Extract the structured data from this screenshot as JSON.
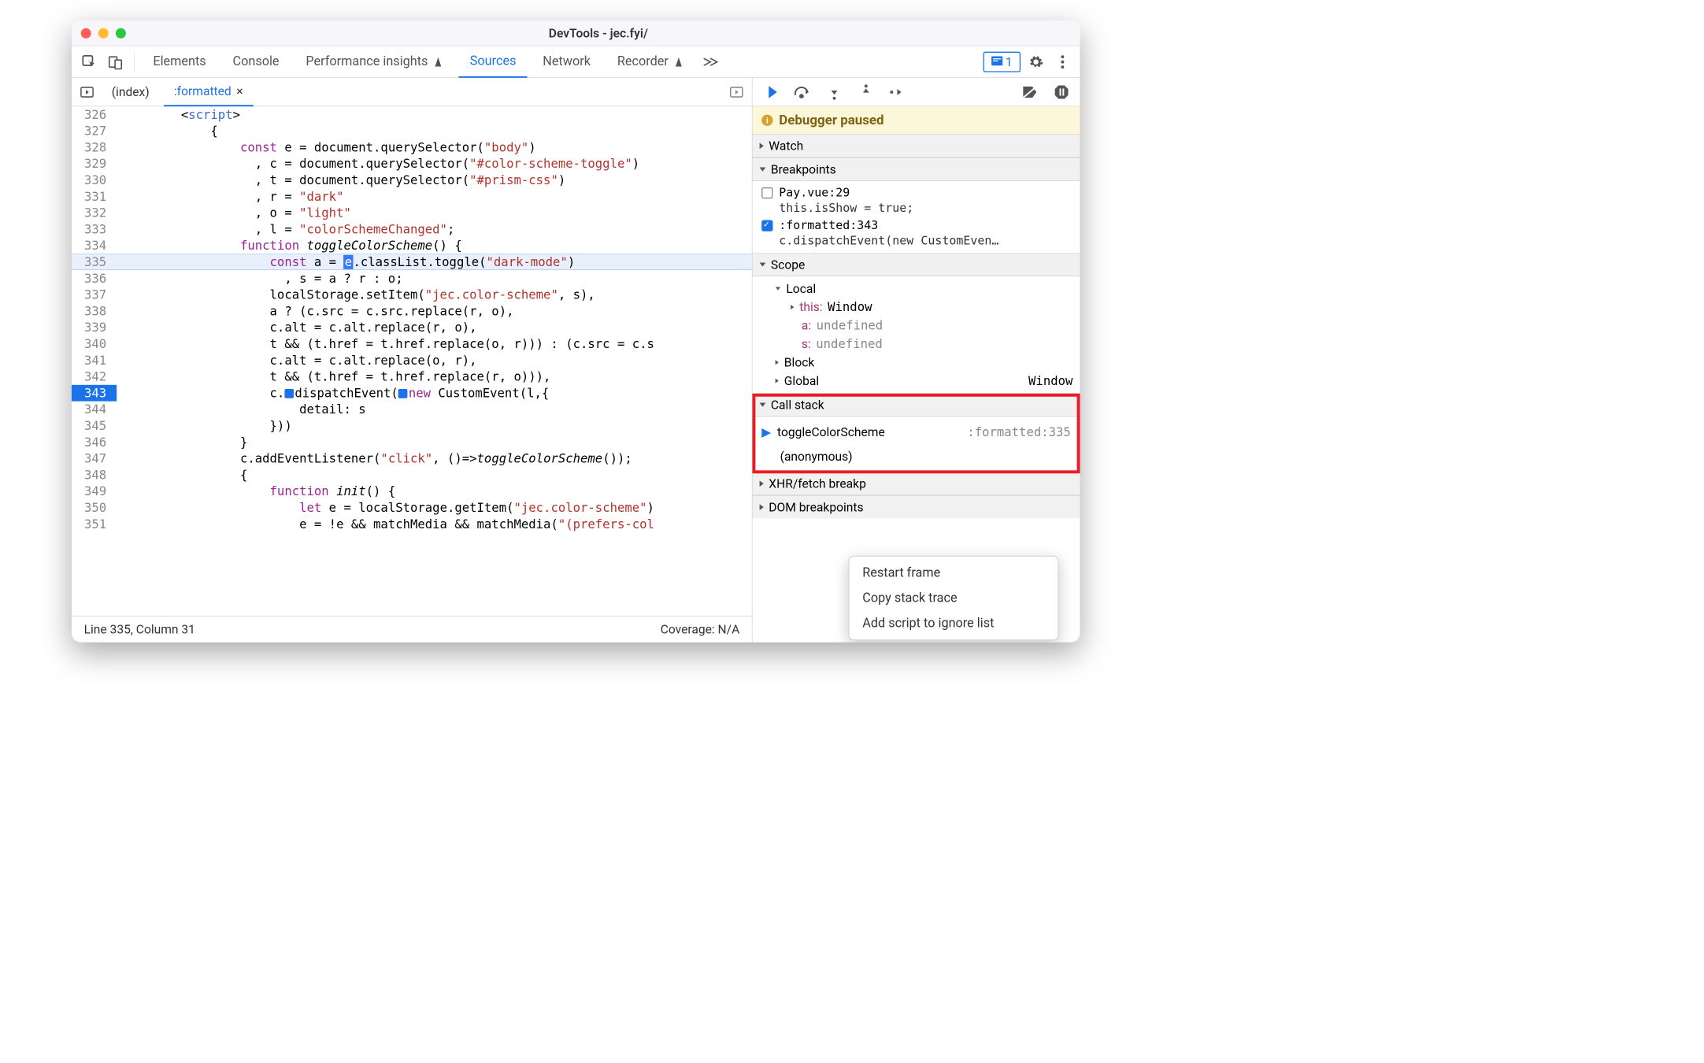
{
  "window": {
    "title": "DevTools - jec.fyi/"
  },
  "tabs": {
    "elements": "Elements",
    "console": "Console",
    "perf": "Performance insights",
    "sources": "Sources",
    "network": "Network",
    "recorder": "Recorder",
    "issues_count": "1"
  },
  "filetabs": {
    "index": "(index)",
    "formatted": ":formatted"
  },
  "lines": {
    "326": "        <script>",
    "327": "            {",
    "328": "                const e = document.querySelector(\"body\")",
    "329": "                  , c = document.querySelector(\"#color-scheme-toggle\")",
    "330": "                  , t = document.querySelector(\"#prism-css\")",
    "331": "                  , r = \"dark\"",
    "332": "                  , o = \"light\"",
    "333": "                  , l = \"colorSchemeChanged\";",
    "334": "                function toggleColorScheme() {",
    "335": "                    const a = e.classList.toggle(\"dark-mode\")",
    "336": "                      , s = a ? r : o;",
    "337": "                    localStorage.setItem(\"jec.color-scheme\", s),",
    "338": "                    a ? (c.src = c.src.replace(r, o),",
    "339": "                    c.alt = c.alt.replace(r, o),",
    "340": "                    t && (t.href = t.href.replace(o, r))) : (c.src = c.s",
    "341": "                    c.alt = c.alt.replace(o, r),",
    "342": "                    t && (t.href = t.href.replace(r, o))),",
    "343": "                    c.dispatchEvent(new CustomEvent(l,{",
    "344": "                        detail: s",
    "345": "                    }))",
    "346": "                }",
    "347": "                c.addEventListener(\"click\", ()=>toggleColorScheme());",
    "348": "                {",
    "349": "                    function init() {",
    "350": "                        let e = localStorage.getItem(\"jec.color-scheme\")",
    "351": "                        e = !e && matchMedia && matchMedia(\"(prefers-col"
  },
  "status": {
    "pos": "Line 335, Column 31",
    "coverage": "Coverage: N/A"
  },
  "debugger": {
    "banner": "Debugger paused",
    "watch": "Watch",
    "breakpoints": {
      "title": "Breakpoints",
      "items": [
        {
          "file": "Pay.vue:29",
          "code": "this.isShow = true;",
          "checked": false
        },
        {
          "file": ":formatted:343",
          "code": "c.dispatchEvent(new CustomEven…",
          "checked": true
        }
      ]
    },
    "scope": {
      "title": "Scope",
      "local": "Local",
      "this": "this:",
      "this_val": "Window",
      "a": "a:",
      "a_val": "undefined",
      "s": "s:",
      "s_val": "undefined",
      "block": "Block",
      "global": "Global",
      "global_val": "Window"
    },
    "callstack": {
      "title": "Call stack",
      "frames": [
        {
          "name": "toggleColorScheme",
          "loc": ":formatted:335"
        },
        {
          "name": "(anonymous)",
          "loc": ""
        }
      ]
    },
    "xhr": "XHR/fetch breakp",
    "dom": "DOM breakpoints"
  },
  "contextmenu": {
    "restart": "Restart frame",
    "copy": "Copy stack trace",
    "ignore": "Add script to ignore list"
  }
}
